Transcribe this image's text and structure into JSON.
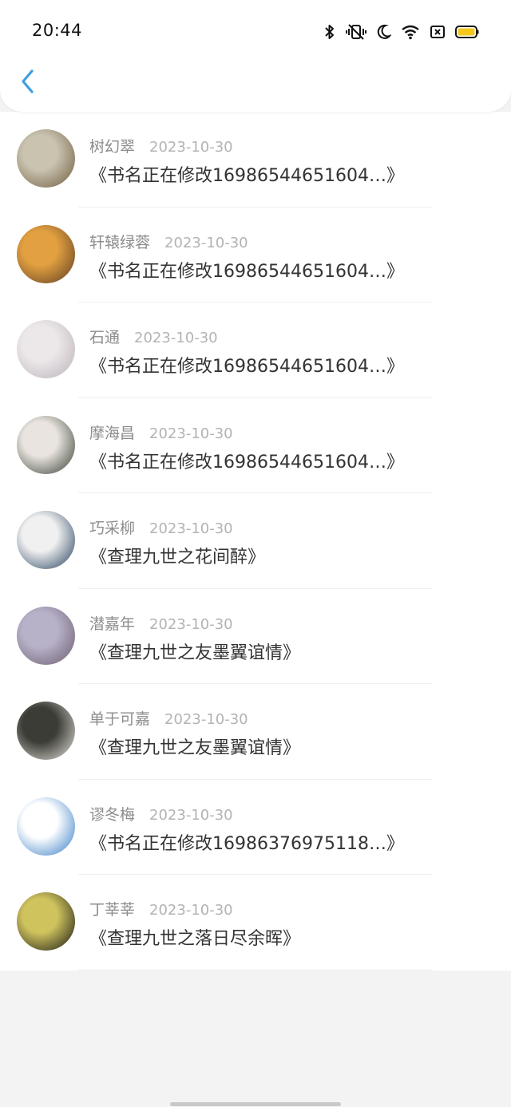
{
  "status_bar": {
    "time": "20:44",
    "icons": [
      "bluetooth-icon",
      "vibrate-off-icon",
      "moon-icon",
      "wifi-icon",
      "sim-x-icon",
      "battery-icon"
    ],
    "battery_color": "#f2c81d"
  },
  "header": {
    "back_icon": "chevron-left-icon",
    "accent": "#3d9fe3"
  },
  "list": {
    "items": [
      {
        "name": "树幻翠",
        "date": "2023-10-30",
        "title": "《书名正在修改16986544651604…》",
        "avatar": [
          "#c9c3b0",
          "#6e5a3c"
        ]
      },
      {
        "name": "轩辕绿蓉",
        "date": "2023-10-30",
        "title": "《书名正在修改16986544651604…》",
        "avatar": [
          "#e2a040",
          "#5a3a22"
        ]
      },
      {
        "name": "石通",
        "date": "2023-10-30",
        "title": "《书名正在修改16986544651604…》",
        "avatar": [
          "#ece8ea",
          "#b9b1b6"
        ]
      },
      {
        "name": "摩海昌",
        "date": "2023-10-30",
        "title": "《书名正在修改16986544651604…》",
        "avatar": [
          "#e9e4df",
          "#2f3a2c"
        ]
      },
      {
        "name": "巧采柳",
        "date": "2023-10-30",
        "title": "《查理九世之花间醉》",
        "avatar": [
          "#f0f0f0",
          "#1e3b5a"
        ]
      },
      {
        "name": "潜嘉年",
        "date": "2023-10-30",
        "title": "《查理九世之友墨翼谊情》",
        "avatar": [
          "#b8b2c9",
          "#6a5b6e"
        ]
      },
      {
        "name": "单于可嘉",
        "date": "2023-10-30",
        "title": "《查理九世之友墨翼谊情》",
        "avatar": [
          "#3c3c36",
          "#e8e6df"
        ]
      },
      {
        "name": "谬冬梅",
        "date": "2023-10-30",
        "title": "《书名正在修改16986376975118…》",
        "avatar": [
          "#ffffff",
          "#2f78c4"
        ]
      },
      {
        "name": "丁莘莘",
        "date": "2023-10-30",
        "title": "《查理九世之落日尽余晖》",
        "avatar": [
          "#cfc35e",
          "#111111"
        ]
      }
    ]
  }
}
